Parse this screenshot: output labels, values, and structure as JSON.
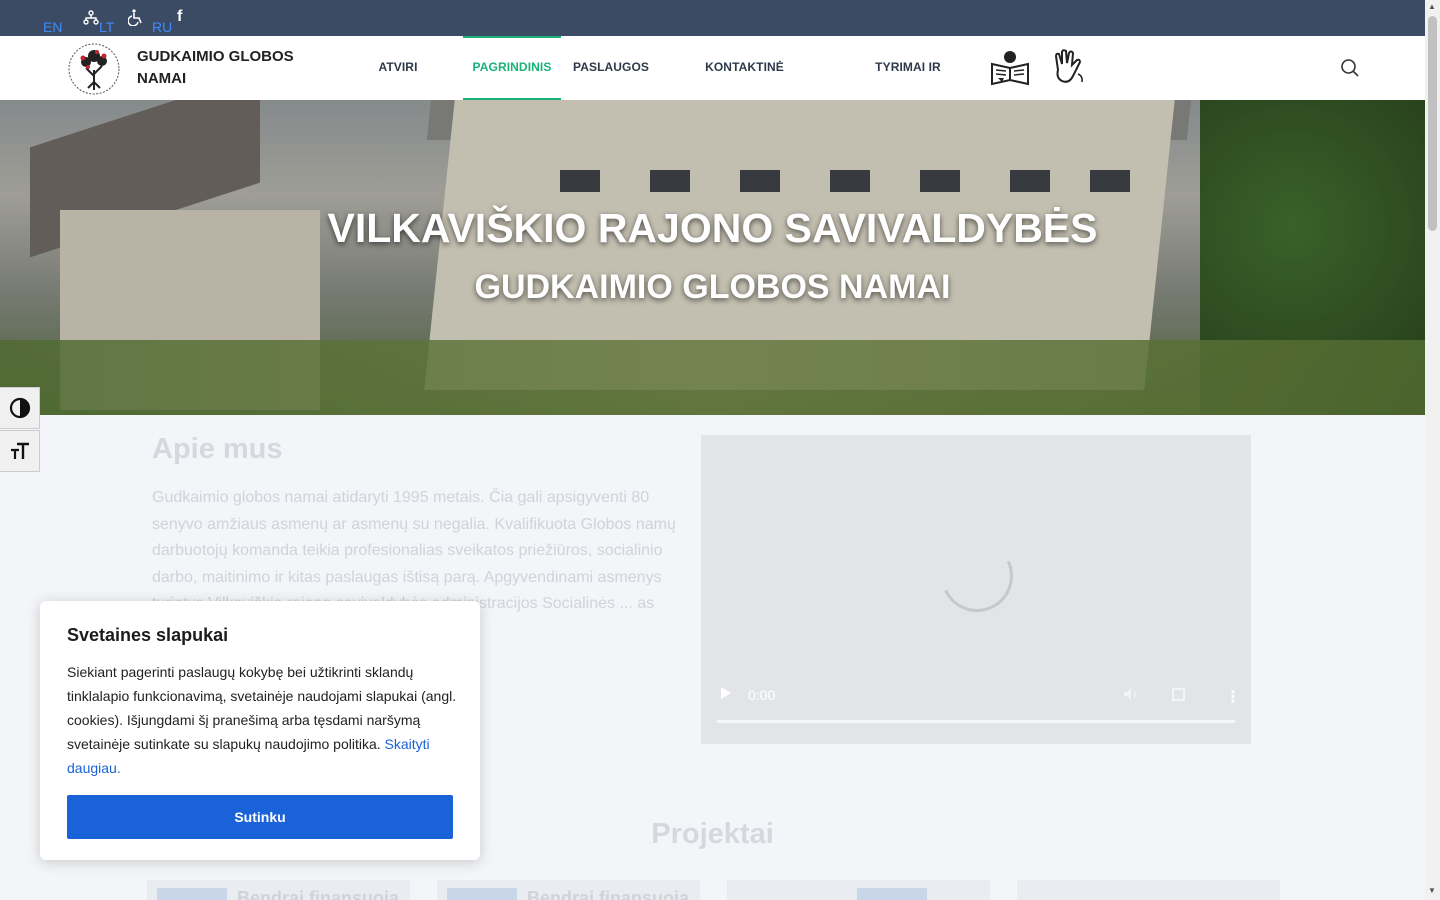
{
  "topbar": {
    "languages": [
      "EN",
      "LT",
      "RU"
    ],
    "icons": [
      "sitemap-icon",
      "wheelchair-icon",
      "facebook-icon"
    ],
    "facebook_glyph": "f"
  },
  "header": {
    "site_name": "GUDKAIMIO GLOBOS NAMAI",
    "nav": [
      {
        "label": "ATVIRI DUOMENYS",
        "active": false
      },
      {
        "label": "PAGRINDINIS",
        "active": true
      },
      {
        "label": "PASLAUGOS",
        "active": false
      },
      {
        "label": "KONTAKTINĖ INFORMACIJA",
        "active": false
      },
      {
        "label": "TYRIMAI IR ANALIZĖS",
        "active": false
      }
    ],
    "accent_color": "#18b27a"
  },
  "hero": {
    "title": "VILKAVIŠKIO RAJONO SAVIVALDYBĖS",
    "subtitle": "GUDKAIMIO GLOBOS NAMAI"
  },
  "about": {
    "title": "Apie mus",
    "text": "Gudkaimio globos namai atidaryti 1995 metais. Čia gali apsigyventi 80 senyvo amžiaus asmenų ar asmenų su negalia. Kvalifikuota Globos namų darbuotojų komanda teikia profesionalias sveikatos priežiūros, socialinio darbo, maitinimo ir kitas paslaugas ištisą parą. Apgyvendinami asmenys turintys Vilkaviškio rajono savivaldybės administracijos Socialinės ... as Vilkaviškio rajono"
  },
  "video": {
    "time": "0:00"
  },
  "projects": {
    "title": "Projektai",
    "cards": [
      "Bendrai finansuoja",
      "Bendrai finansuoja",
      "",
      ""
    ]
  },
  "cookie": {
    "title": "Svetaines slapukai",
    "text": "Siekiant pagerinti paslaugų kokybę bei užtikrinti sklandų tinklalapio funkcionavimą, svetainėje naudojami slapukai (angl. cookies). Išjungdami šį pranešimą arba tęsdami naršymą svetainėje sutinkate su slapukų naudojimo politika.",
    "link_text": "Skaityti daugiau.",
    "accept_label": "Sutinku",
    "button_color": "#1a62d8"
  }
}
